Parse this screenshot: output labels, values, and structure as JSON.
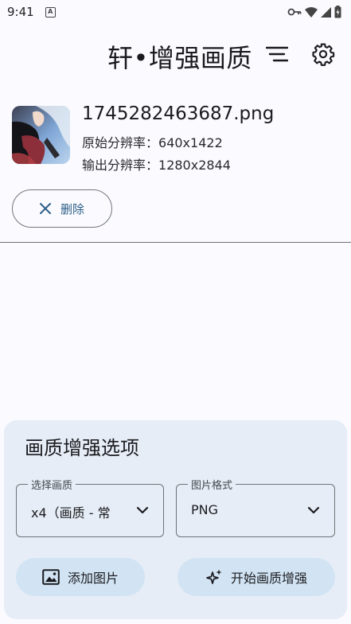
{
  "status_bar": {
    "time": "9:41",
    "app_indicator": "A"
  },
  "app_bar": {
    "title": "轩•增强画质",
    "icons": [
      "sort-icon",
      "settings-gear-icon"
    ]
  },
  "image_item": {
    "file_name": "1745282463687.png",
    "original_resolution_label": "原始分辨率：",
    "original_resolution": "640x1422",
    "output_resolution_label": "输出分辨率：",
    "output_resolution": "1280x2844"
  },
  "delete_button": {
    "label": "删除",
    "icon": "close-icon"
  },
  "options": {
    "title": "画质增强选项",
    "quality_field": {
      "label": "选择画质",
      "value": "x4（画质 - 常"
    },
    "format_field": {
      "label": "图片格式",
      "value": "PNG"
    },
    "add_image_button": "添加图片",
    "start_button": "开始画质增强"
  },
  "colors": {
    "background": "#fafaff",
    "panel": "#e6edf6",
    "tonal_button": "#d2e4f4",
    "accent": "#2e5f86"
  }
}
